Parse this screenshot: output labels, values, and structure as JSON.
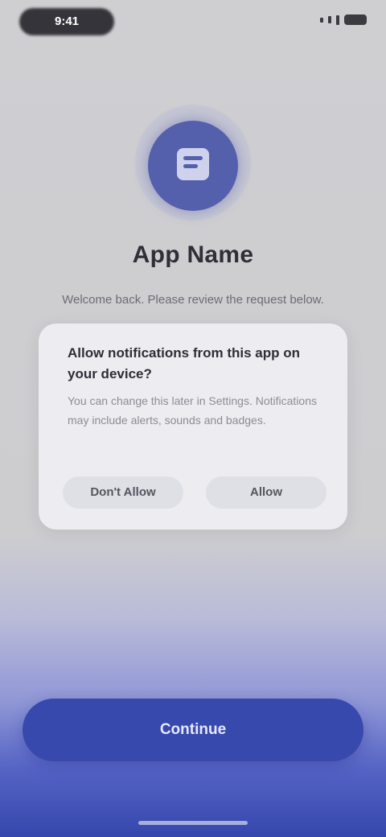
{
  "status_bar": {
    "time": "9:41"
  },
  "app": {
    "icon": "app-icon",
    "title": "App Name",
    "subtitle": "Welcome back. Please review the request below."
  },
  "dialog": {
    "title": "Allow notifications from this app on your device?",
    "body": "You can change this later in Settings. Notifications may include alerts, sounds and badges.",
    "buttons": {
      "deny": "Don't Allow",
      "allow": "Allow"
    }
  },
  "cta": {
    "label": "Continue"
  },
  "colors": {
    "accent": "#3849ad",
    "icon_bg": "#5560ad"
  }
}
